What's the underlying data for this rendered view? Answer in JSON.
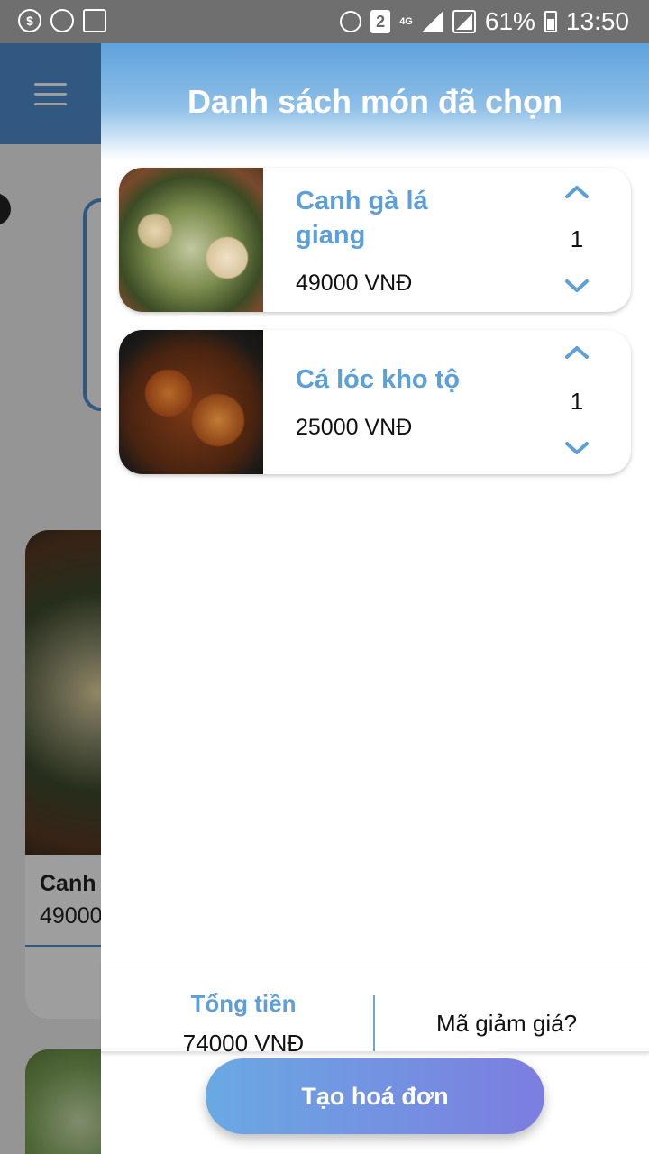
{
  "status_bar": {
    "sim_slot": "2",
    "network": "4G",
    "battery_percent": "61%",
    "time": "13:50"
  },
  "background": {
    "card_title": "Canh",
    "card_price": "49000"
  },
  "drawer": {
    "title": "Danh sách món đã chọn",
    "items": [
      {
        "name": "Canh gà lá giang",
        "price": "49000 VNĐ",
        "quantity": "1"
      },
      {
        "name": "Cá lóc kho tộ",
        "price": "25000 VNĐ",
        "quantity": "1"
      }
    ],
    "total_label": "Tổng tiền",
    "total_value": "74000 VNĐ",
    "coupon_label": "Mã giảm giá?",
    "create_invoice_label": "Tạo hoá đơn"
  },
  "colors": {
    "accent": "#5d9fd8",
    "button_gradient_start": "#6aa9e3",
    "button_gradient_end": "#7c7de0"
  }
}
